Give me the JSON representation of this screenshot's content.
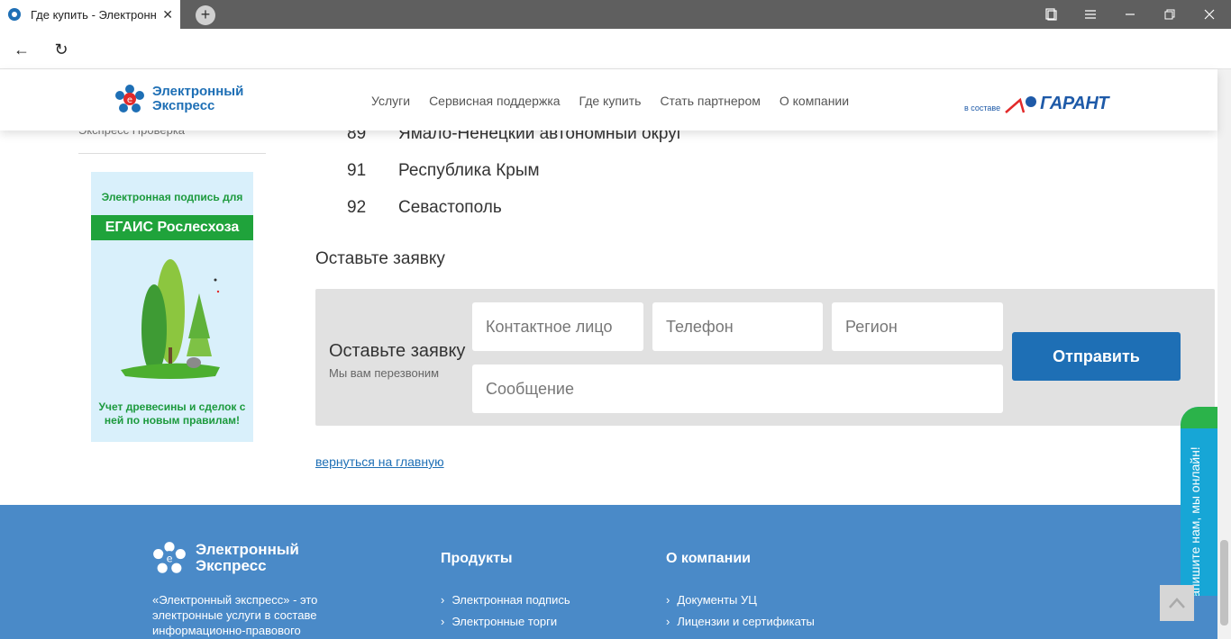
{
  "browser": {
    "tab_title": "Где купить - Электронн",
    "close_glyph": "✕",
    "new_tab_glyph": "+",
    "back_glyph": "←",
    "reload_glyph": "↻"
  },
  "header": {
    "logo_text": "Электронный Экспресс",
    "menu": [
      "Услуги",
      "Сервисная поддержка",
      "Где купить",
      "Стать партнером",
      "О компании"
    ],
    "partner_small": "в составе",
    "partner_name": "ГАРАНТ"
  },
  "sidebar": {
    "link": "Экспресс Проверка",
    "banner_top": "Электронная подпись для",
    "banner_bar": "ЕГАИС Рослесхоза",
    "banner_bottom": "Учет древесины и сделок с ней по новым правилам!"
  },
  "regions": [
    {
      "code": "89",
      "name": "Ямало-Ненецкий автономный округ"
    },
    {
      "code": "91",
      "name": "Республика Крым"
    },
    {
      "code": "92",
      "name": "Севастополь"
    }
  ],
  "request": {
    "section_title": "Оставьте заявку",
    "form_title": "Оставьте заявку",
    "form_subtitle": "Мы вам перезвоним",
    "contact_placeholder": "Контактное лицо",
    "phone_placeholder": "Телефон",
    "region_placeholder": "Регион",
    "message_placeholder": "Сообщение",
    "submit_label": "Отправить"
  },
  "back_link": "вернуться на главную",
  "footer": {
    "logo_text": "Электронный Экспресс",
    "description": "«Электронный экспресс» - это электронные услуги в составе информационно-правового",
    "products_title": "Продукты",
    "products": [
      "Электронная подпись",
      "Электронные торги"
    ],
    "company_title": "О компании",
    "company": [
      "Документы УЦ",
      "Лицензии и сертификаты"
    ]
  },
  "chat_widget": "Напишите нам, мы онлайн!",
  "colors": {
    "brand_blue": "#1e6fb5",
    "footer_blue": "#4a8ac8",
    "banner_green": "#1fa33b"
  }
}
